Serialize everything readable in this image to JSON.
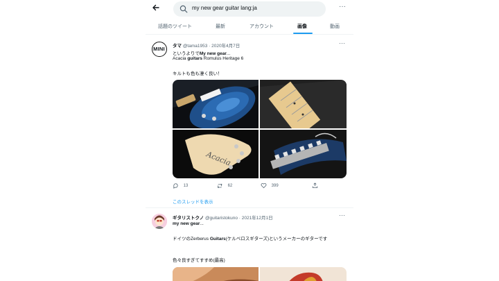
{
  "search": {
    "query": "my new gear guitar lang:ja"
  },
  "tabs": [
    {
      "label": "話題のツイート"
    },
    {
      "label": "最新"
    },
    {
      "label": "アカウント"
    },
    {
      "label": "画像"
    },
    {
      "label": "動画"
    }
  ],
  "tweets": [
    {
      "avatar_text": "MINI",
      "name": "タマ",
      "handle": "@tama1953 · 2020年4月7日",
      "line1_prefix": "というよりで",
      "line1_bold": "My new gear",
      "line1_suffix": "...",
      "line2_prefix": "Acacia ",
      "line2_bold": "guitars",
      "line2_suffix": " Romulus Heritage 6",
      "line3": "キルトも色も凄く良い！",
      "replies": "13",
      "retweets": "62",
      "likes": "399",
      "thread_link": "このスレッドを表示"
    },
    {
      "name": "ギタリストクノ",
      "handle": "@guitaristokuno · 2021年12月1日",
      "line1_bold": "my new gear",
      "line1_suffix": "...",
      "line2_prefix": "ドイツのZerberus ",
      "line2_bold": "Guitars",
      "line2_suffix": "(ケルベロスギターズ)というメーカーのギターです",
      "line3": "色々良すぎてすすめ(最高)"
    }
  ],
  "colors": {
    "accent": "#1d9bf0",
    "text": "#0f1419",
    "muted": "#536471"
  }
}
